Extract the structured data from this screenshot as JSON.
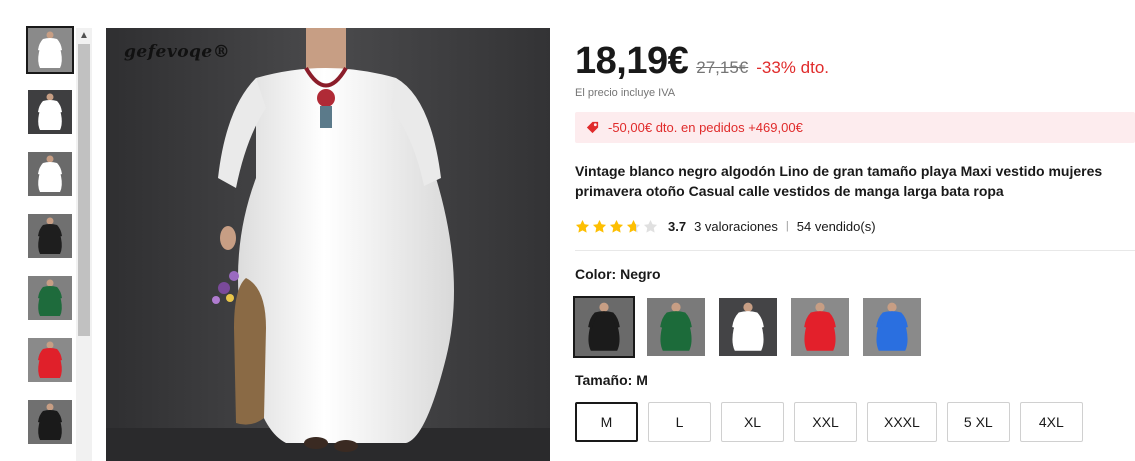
{
  "gallery": {
    "thumbnails": [
      {
        "label": "white-dress",
        "bg": "#8a8a8a",
        "dress": "#ffffff"
      },
      {
        "label": "white-dress",
        "bg": "#3e3e40",
        "dress": "#ffffff"
      },
      {
        "label": "white-dress",
        "bg": "#6a6a6a",
        "dress": "#ffffff"
      },
      {
        "label": "black-dress",
        "bg": "#707070",
        "dress": "#1e1e1e"
      },
      {
        "label": "green-dress",
        "bg": "#808080",
        "dress": "#1e6b3c"
      },
      {
        "label": "red-dress",
        "bg": "#8a8a8a",
        "dress": "#e0202a"
      },
      {
        "label": "black-dress",
        "bg": "#707070",
        "dress": "#1a1a1a"
      }
    ],
    "brand_watermark": "gefevoqe®"
  },
  "product": {
    "price": "18,19€",
    "old_price": "27,15€",
    "discount": "-33% dto.",
    "tax_note": "El precio incluye IVA",
    "coupon": "-50,00€ dto. en pedidos +469,00€",
    "title": "Vintage blanco negro algodón Lino de gran tamaño playa Maxi vestido mujeres primavera otoño Casual calle vestidos de manga larga bata ropa",
    "rating": {
      "value": "3.7",
      "stars_filled": 3.7,
      "reviews": "3 valoraciones",
      "sold": "54 vendido(s)"
    },
    "color": {
      "label": "Color: ",
      "selected": "Negro",
      "options": [
        {
          "name": "Negro",
          "dress": "#1b1b1b",
          "bg": "#6a6a6a"
        },
        {
          "name": "Verde",
          "dress": "#1c6b3a",
          "bg": "#7a7a7a"
        },
        {
          "name": "Blanco",
          "dress": "#ffffff",
          "bg": "#444446"
        },
        {
          "name": "Rojo",
          "dress": "#e3202b",
          "bg": "#8a8a8a"
        },
        {
          "name": "Azul",
          "dress": "#2a6fe0",
          "bg": "#8a8a8a"
        }
      ]
    },
    "size": {
      "label": "Tamaño: ",
      "selected": "M",
      "options": [
        "M",
        "L",
        "XL",
        "XXL",
        "XXXL",
        "5 XL",
        "4XL"
      ]
    }
  },
  "colors": {
    "accent_red": "#e02b2b",
    "coupon_bg": "#fdecee",
    "star": "#fdbf02",
    "text": "#191919",
    "muted": "#757575"
  }
}
